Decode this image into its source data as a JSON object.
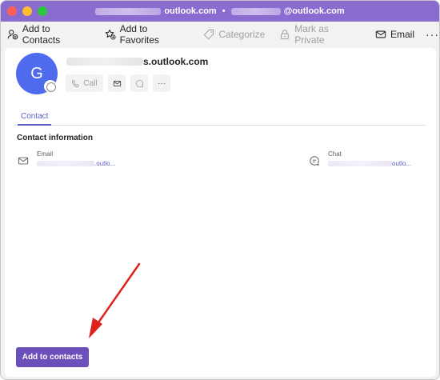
{
  "window": {
    "title_left_suffix": "outlook.com",
    "title_separator": "•",
    "title_right_suffix": "@outlook.com"
  },
  "toolbar": {
    "items": [
      {
        "label": "Add to Contacts",
        "icon": "person-add-icon",
        "enabled": true
      },
      {
        "label": "Add to Favorites",
        "icon": "star-add-icon",
        "enabled": true
      },
      {
        "label": "Categorize",
        "icon": "tag-icon",
        "enabled": false
      },
      {
        "label": "Mark as Private",
        "icon": "lock-icon",
        "enabled": false
      },
      {
        "label": "Email",
        "icon": "mail-icon",
        "enabled": true
      }
    ],
    "more_label": "···"
  },
  "contact": {
    "initial": "G",
    "name_suffix": "s.outlook.com",
    "actions": {
      "call_label": "Call",
      "more_label": "···"
    }
  },
  "tabs": [
    {
      "label": "Contact",
      "selected": true
    }
  ],
  "contact_info": {
    "heading": "Contact information",
    "email": {
      "label": "Email",
      "value_suffix": ".outlo..."
    },
    "chat": {
      "label": "Chat",
      "value_suffix": "outlo..."
    }
  },
  "footer": {
    "add_button_label": "Add to contacts"
  },
  "colors": {
    "titlebar": "#8a6bd0",
    "avatar": "#4f6bed",
    "accent": "#5b5fc7",
    "primary_button": "#6b4fbb",
    "annotation_arrow": "#e0201b"
  }
}
